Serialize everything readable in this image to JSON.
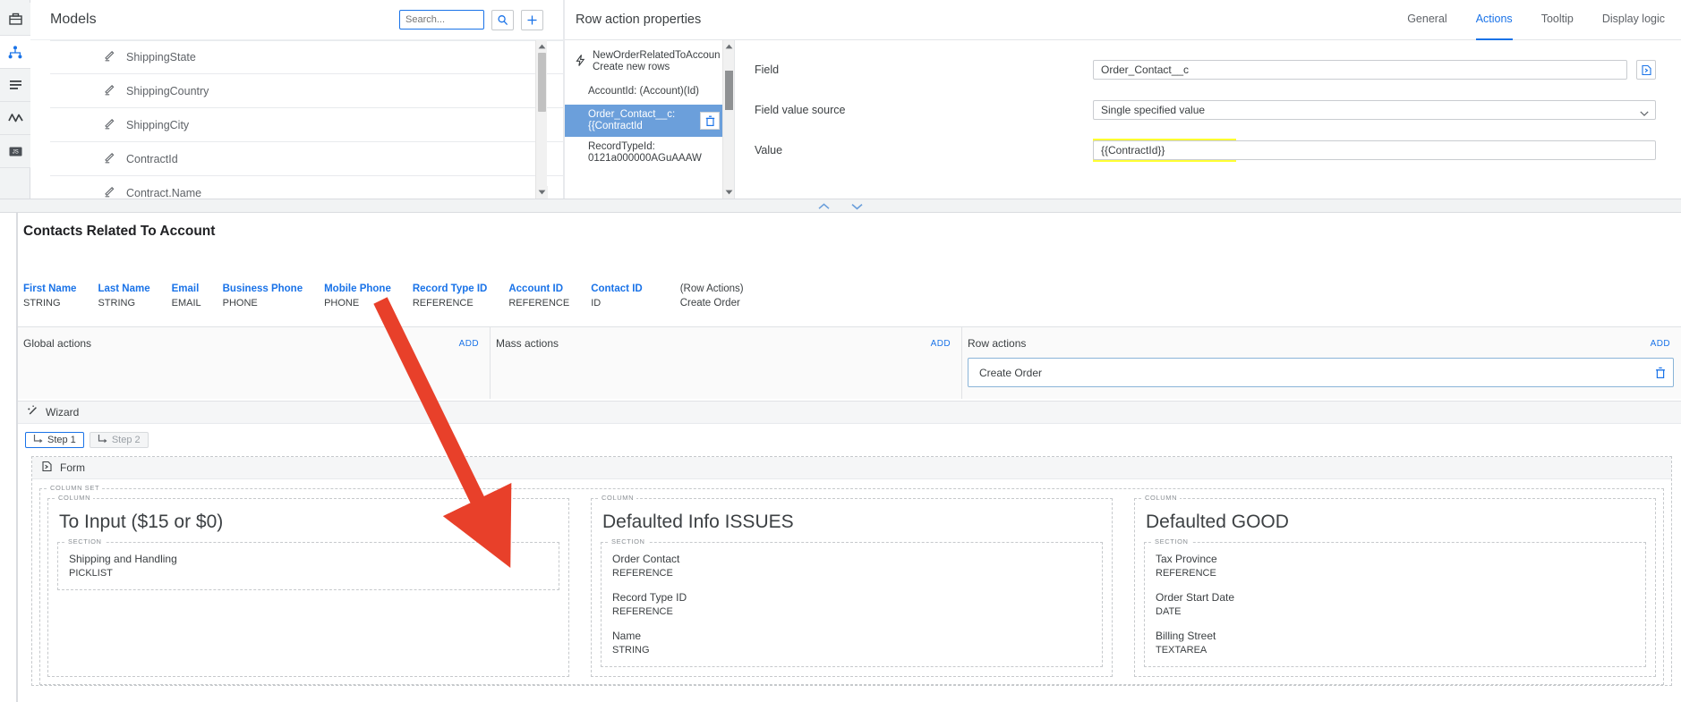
{
  "rail": {
    "items": [
      {
        "name": "toolbox-icon",
        "label": "Toolbox",
        "active": false
      },
      {
        "name": "model-hierarchy-icon",
        "label": "Models",
        "active": true
      },
      {
        "name": "list-icon",
        "label": "Pages",
        "active": false
      },
      {
        "name": "activity-icon",
        "label": "Logic",
        "active": false
      },
      {
        "name": "javascript-icon",
        "label": "JS",
        "active": false
      }
    ]
  },
  "models": {
    "title": "Models",
    "search_placeholder": "Search...",
    "search_value": "",
    "search_button": "search-icon",
    "add_button": "plus-icon",
    "rows": [
      {
        "label": "ShippingState"
      },
      {
        "label": "ShippingCountry"
      },
      {
        "label": "ShippingCity"
      },
      {
        "label": "ContractId"
      },
      {
        "label": "Contract.Name"
      }
    ]
  },
  "row_action_properties": {
    "title": "Row action properties",
    "tabs": [
      {
        "label": "General",
        "active": false
      },
      {
        "label": "Actions",
        "active": true
      },
      {
        "label": "Tooltip",
        "active": false
      },
      {
        "label": "Display logic",
        "active": false
      }
    ],
    "action_tree": [
      {
        "label": "NewOrderRelatedToAccount: Create new rows",
        "selected": false,
        "root": true
      },
      {
        "label": "AccountId: (Account)(Id)",
        "selected": false,
        "root": false
      },
      {
        "label": "Order_Contact__c: {{ContractId",
        "selected": true,
        "root": false
      },
      {
        "label": "RecordTypeId: 0121a000000AGuAAAW",
        "selected": false,
        "root": false
      }
    ],
    "fields": {
      "field_label": "Field",
      "field_value": "Order_Contact__c",
      "field_value_source_label": "Field value source",
      "field_value_source_value": "Single specified value",
      "value_label": "Value",
      "value_value": "{{ContractId}}",
      "highlight_color": "#ffff33"
    }
  },
  "preview": {
    "table_title": "Contacts Related To Account",
    "columns": [
      {
        "header": "First Name",
        "type": "STRING"
      },
      {
        "header": "Last Name",
        "type": "STRING"
      },
      {
        "header": "Email",
        "type": "EMAIL"
      },
      {
        "header": "Business Phone",
        "type": "PHONE"
      },
      {
        "header": "Mobile Phone",
        "type": "PHONE"
      },
      {
        "header": "Record Type ID",
        "type": "REFERENCE"
      },
      {
        "header": "Account ID",
        "type": "REFERENCE"
      },
      {
        "header": "Contact ID",
        "type": "ID"
      }
    ],
    "row_actions_column": {
      "header": "(Row Actions)",
      "value": "Create Order"
    },
    "action_groups": [
      {
        "title": "Global actions",
        "add_label": "ADD",
        "chips": []
      },
      {
        "title": "Mass actions",
        "add_label": "ADD",
        "chips": []
      },
      {
        "title": "Row actions",
        "add_label": "ADD",
        "chips": [
          {
            "label": "Create Order"
          }
        ]
      }
    ],
    "wizard": {
      "label": "Wizard",
      "steps": [
        {
          "label": "Step 1",
          "active": true
        },
        {
          "label": "Step 2",
          "active": false
        }
      ]
    },
    "form": {
      "label": "Form",
      "column_set_tag": "COLUMN SET",
      "column_tag": "COLUMN",
      "section_tag": "SECTION",
      "columns": [
        {
          "heading": "To Input ($15 or $0)",
          "fields": [
            {
              "name": "Shipping and Handling",
              "type": "PICKLIST"
            }
          ]
        },
        {
          "heading": "Defaulted Info ISSUES",
          "fields": [
            {
              "name": "Order Contact",
              "type": "REFERENCE"
            },
            {
              "name": "Record Type ID",
              "type": "REFERENCE"
            },
            {
              "name": "Name",
              "type": "STRING"
            }
          ]
        },
        {
          "heading": "Defaulted GOOD",
          "fields": [
            {
              "name": "Tax Province",
              "type": "REFERENCE"
            },
            {
              "name": "Order Start Date",
              "type": "DATE"
            },
            {
              "name": "Billing Street",
              "type": "TEXTAREA"
            }
          ]
        }
      ]
    }
  },
  "annotation": {
    "arrow_color": "#e8402a"
  }
}
